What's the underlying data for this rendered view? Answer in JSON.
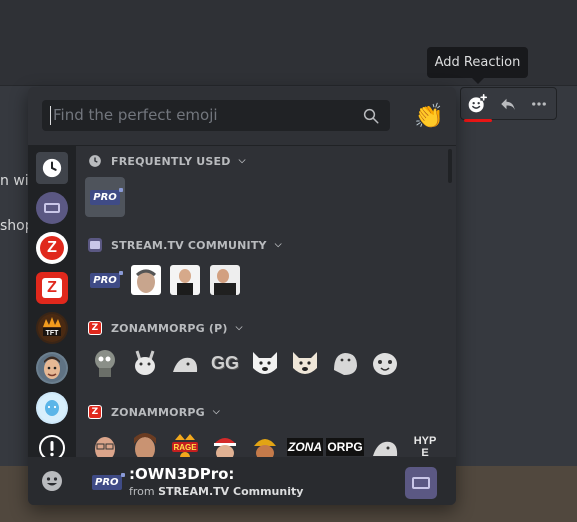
{
  "background": {
    "line1": "n wit",
    "line2": "shop"
  },
  "tooltip": {
    "text": "Add Reaction"
  },
  "message_actions": [
    {
      "name": "add-reaction",
      "icon": "add-reaction-icon"
    },
    {
      "name": "reply",
      "icon": "reply-icon"
    },
    {
      "name": "more",
      "icon": "more-icon"
    }
  ],
  "picker": {
    "search": {
      "placeholder": "Find the perfect emoji"
    },
    "categories": [
      "recent-icon",
      "stream-tv-icon",
      "zonammorpg-icon",
      "zonammorpg-alt-icon",
      "tft-icon",
      "face-icon",
      "balloon-icon",
      "info-icon"
    ],
    "sections": [
      {
        "title": "FREQUENTLY USED",
        "icon": "clock-icon"
      },
      {
        "title": "STREAM.TV COMMUNITY",
        "icon": "stream-tv-icon"
      },
      {
        "title": "ZONAMMORPG (P)",
        "icon": "zonammorpg-icon"
      },
      {
        "title": "ZONAMMORPG",
        "icon": "zonammorpg-icon"
      }
    ],
    "emoji_text": {
      "pro": "PRO",
      "gg": "GG",
      "rage": "RAGE",
      "zona": "ZONA",
      "orpg": "ORPG",
      "hype": "HYPE"
    },
    "footer": {
      "emoji_name": ":OWN3DPro:",
      "from_prefix": "from ",
      "from_source": "STREAM.TV Community"
    }
  },
  "colors": {
    "accent": "#3f4b86",
    "brand_red": "#e81515",
    "bg_panel": "#2f3136",
    "bg_dark": "#202225"
  }
}
